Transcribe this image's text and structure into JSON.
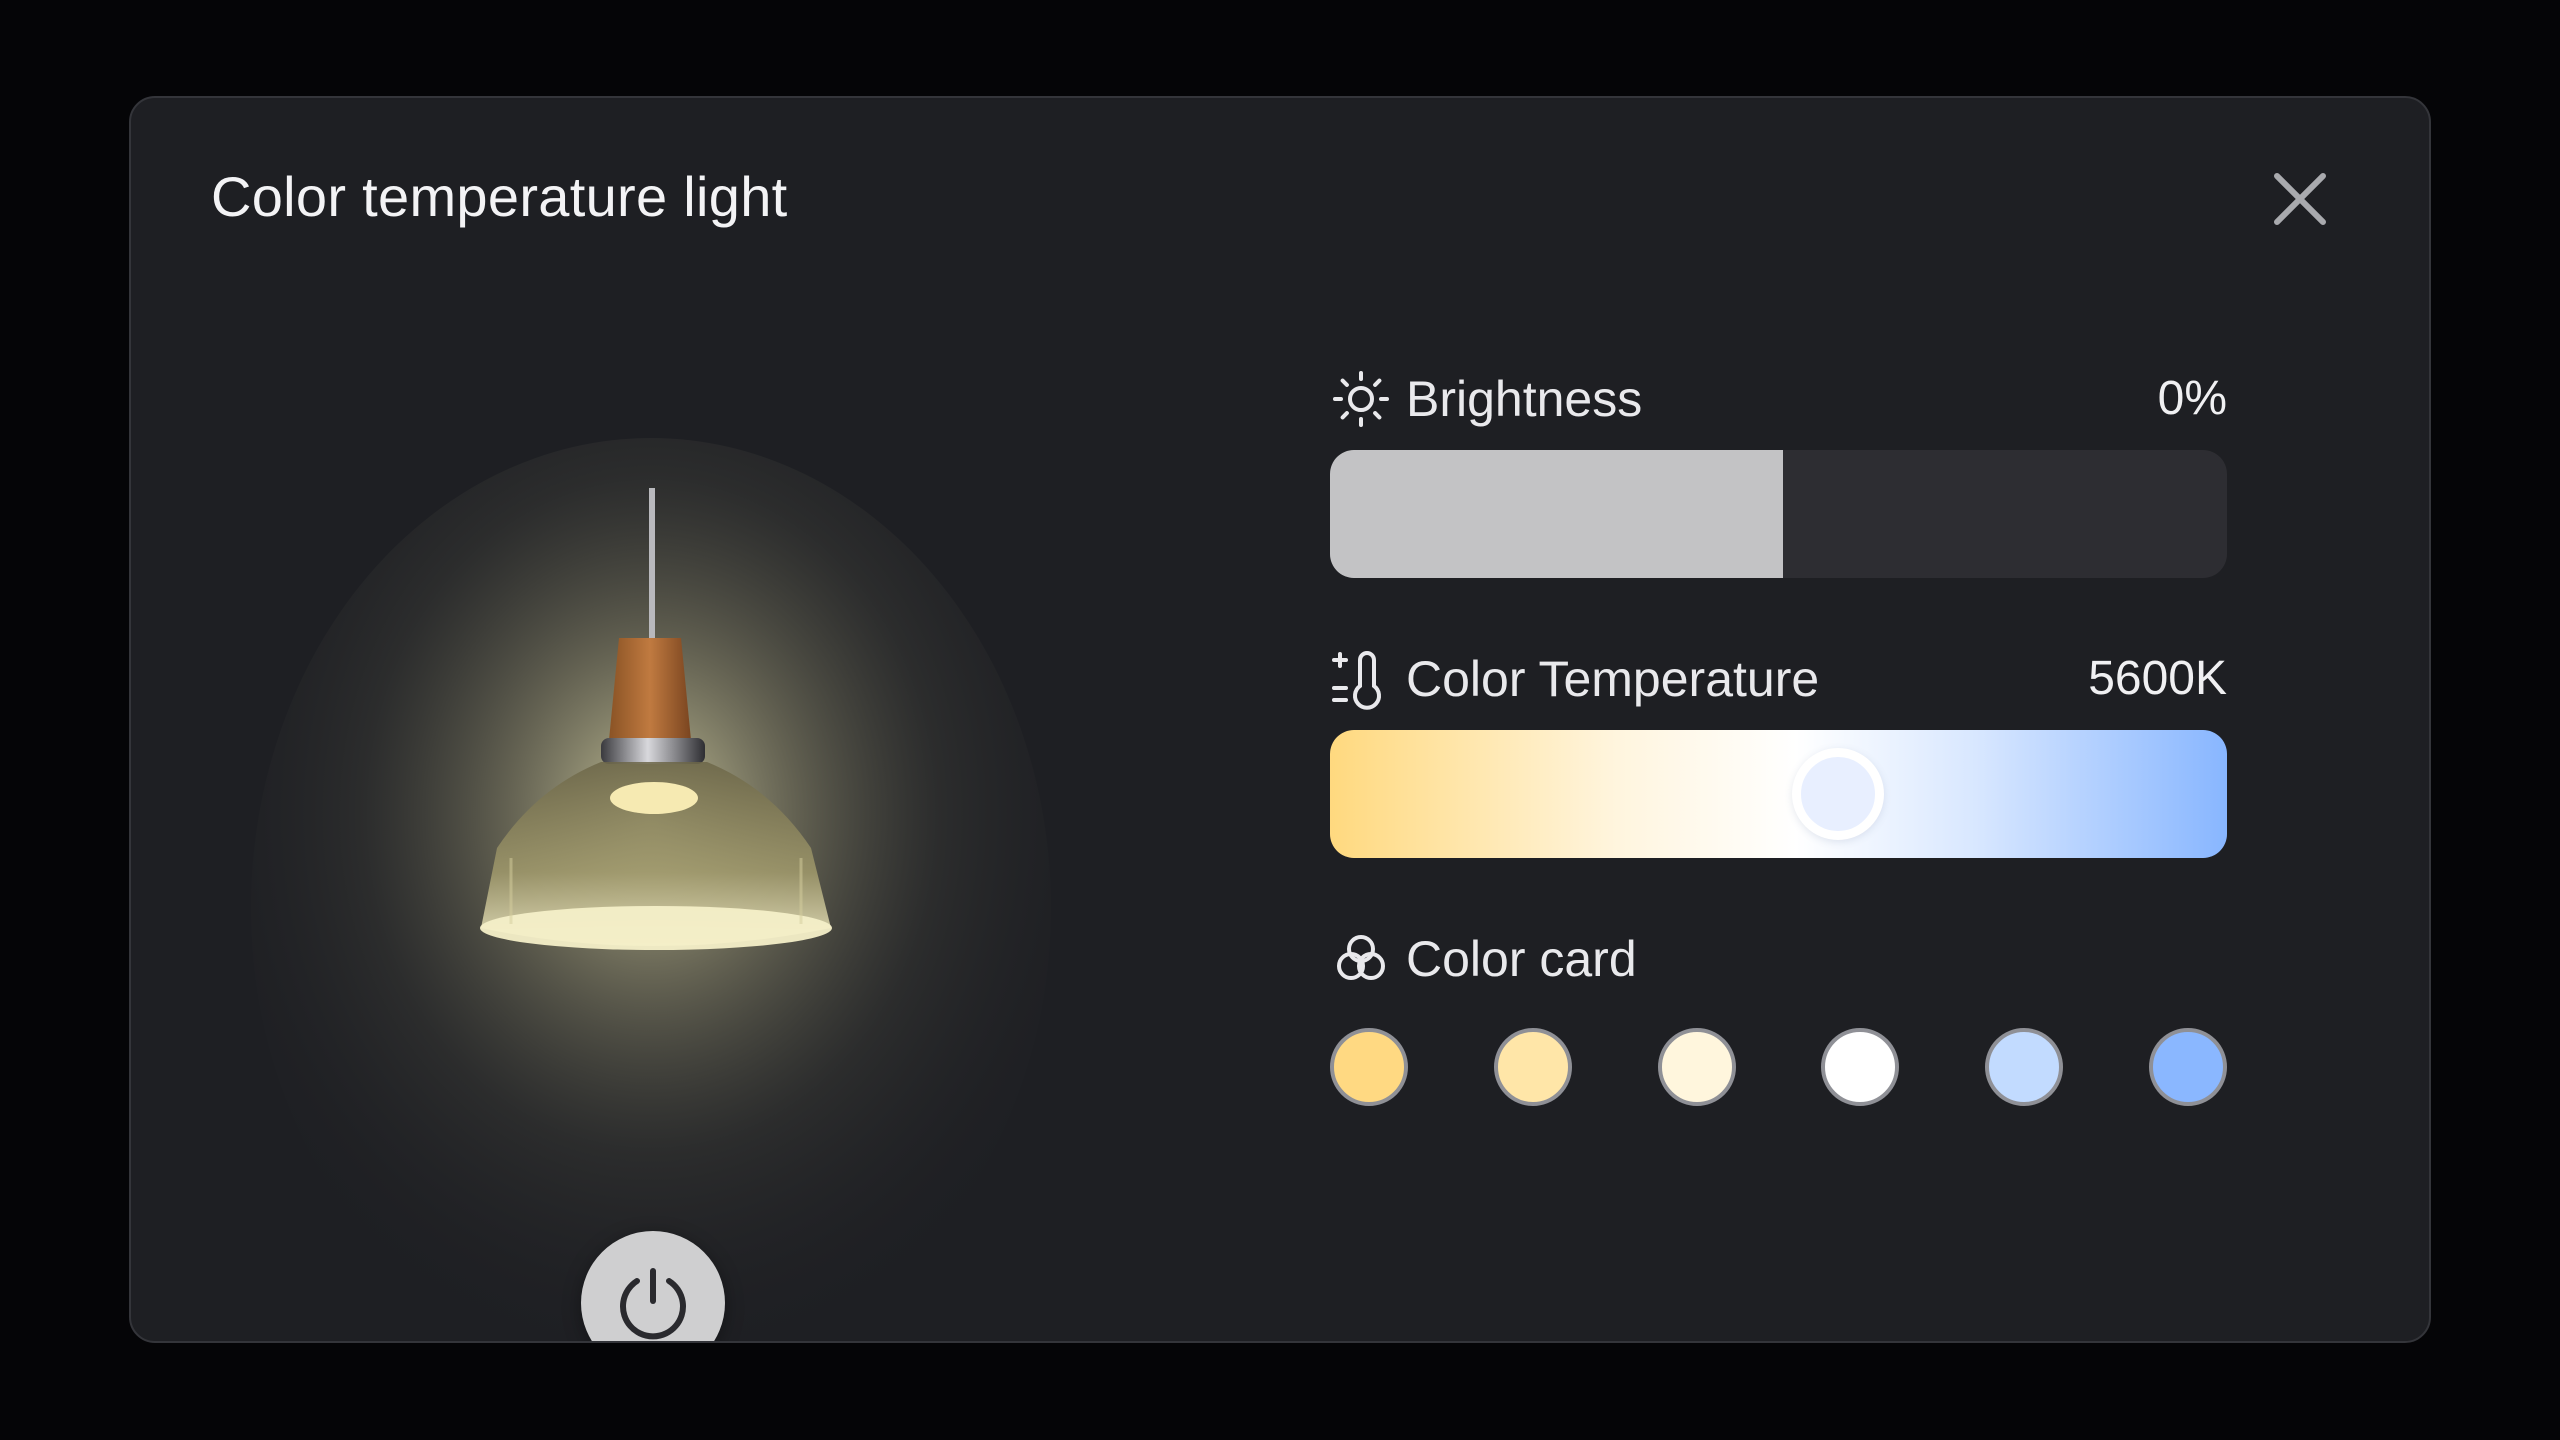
{
  "dialog": {
    "title": "Color temperature light"
  },
  "brightness": {
    "label": "Brightness",
    "value_text": "0%",
    "fill_fraction": 0.505
  },
  "color_temperature": {
    "label": "Color Temperature",
    "value_text": "5600K",
    "knob_fraction": 0.566
  },
  "color_card": {
    "label": "Color card",
    "swatches": [
      "#ffd982",
      "#ffe6a8",
      "#fff6dd",
      "#ffffff",
      "#c2dbff",
      "#8ab7ff"
    ]
  },
  "colors": {
    "background": "#050507",
    "panel": "#1e1f23",
    "brightness_fill": "#c3c3c5",
    "brightness_track": "#2d2d32",
    "power_button": "#cfcfd0"
  }
}
